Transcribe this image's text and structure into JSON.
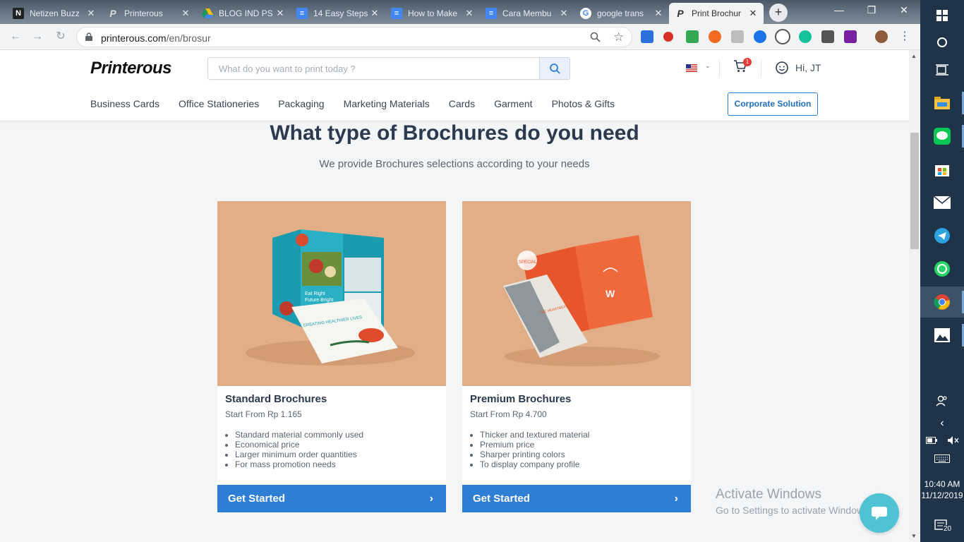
{
  "browser": {
    "tabs": [
      {
        "title": "Netizen Buzz",
        "icon": "netizen-favicon"
      },
      {
        "title": "Printerous",
        "icon": "printerous-favicon"
      },
      {
        "title": "BLOG IND PS",
        "icon": "google-drive-favicon"
      },
      {
        "title": "14 Easy Steps",
        "icon": "google-docs-favicon"
      },
      {
        "title": "How to Make",
        "icon": "google-docs-favicon"
      },
      {
        "title": "Cara Membu",
        "icon": "google-docs-favicon"
      },
      {
        "title": "google trans",
        "icon": "google-favicon"
      },
      {
        "title": "Print Brochur",
        "icon": "printerous-favicon"
      }
    ],
    "url_domain": "printerous.com",
    "url_path": "/en/brosur",
    "new_tab": "+",
    "minimize": "—",
    "restore": "❐",
    "close": "✕"
  },
  "site": {
    "logo": "Printerous",
    "search_placeholder": "What do you want to print today ?",
    "cart_count": "1",
    "greeting": "Hi, JT",
    "menu": [
      "Business Cards",
      "Office Stationeries",
      "Packaging",
      "Marketing Materials",
      "Cards",
      "Garment",
      "Photos & Gifts"
    ],
    "corporate_button": "Corporate Solution"
  },
  "main": {
    "heading": "What type of Brochures do you need",
    "subheading": "We provide Brochures selections according to your needs",
    "products": [
      {
        "name": "Standard Brochures",
        "price": "Start From Rp 1.165",
        "features": [
          "Standard material commonly used",
          "Economical price",
          "Larger minimum order quantities",
          "For mass promotion needs"
        ],
        "cta": "Get Started",
        "image_text": [
          "Eat Right",
          "Future Bright",
          "CREATING HEALTHIER LIVES"
        ]
      },
      {
        "name": "Premium Brochures",
        "price": "Start From Rp 4.700",
        "features": [
          "Thicker and textured material",
          "Premium price",
          "Sharper printing colors",
          "To display company profile"
        ],
        "cta": "Get Started",
        "image_text": [
          "SPECIAL",
          "THE HEARTBEAT OF RIDER",
          "W"
        ]
      }
    ]
  },
  "overlay": {
    "watermark_title": "Activate Windows",
    "watermark_sub": "Go to Settings to activate Windows."
  },
  "taskbar": {
    "time": "10:40 AM",
    "date": "11/12/2019",
    "notifications": "20"
  }
}
